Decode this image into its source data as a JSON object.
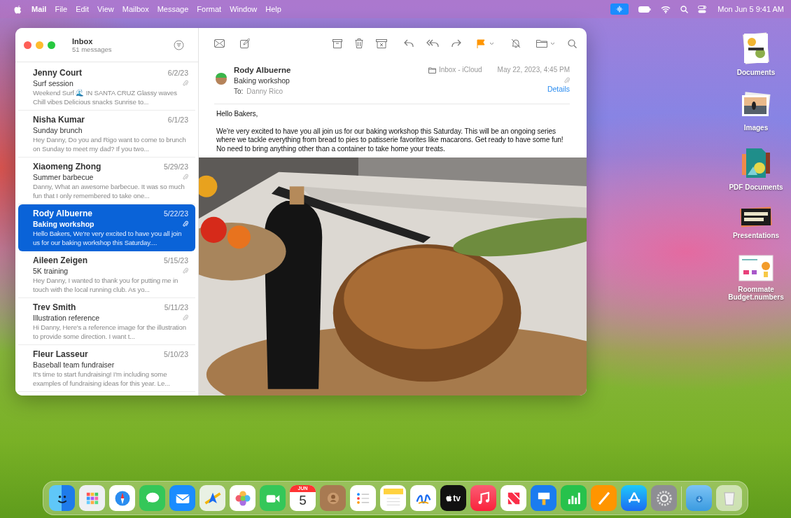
{
  "menu_bar": {
    "app": "Mail",
    "items": [
      "File",
      "Edit",
      "View",
      "Mailbox",
      "Message",
      "Format",
      "Window",
      "Help"
    ],
    "clock": "Mon Jun 5 9:41 AM"
  },
  "mailbox": {
    "title": "Inbox",
    "count": "51 messages"
  },
  "messages": [
    {
      "sender": "Jenny Court",
      "date": "6/2/23",
      "subject": "Surf session",
      "preview": "Weekend Surf 🌊 IN SANTA CRUZ Glassy waves Chill vibes Delicious snacks Sunrise to...",
      "attachment": true,
      "selected": false
    },
    {
      "sender": "Nisha Kumar",
      "date": "6/1/23",
      "subject": "Sunday brunch",
      "preview": "Hey Danny, Do you and Rigo want to come to brunch on Sunday to meet my dad? If you two...",
      "attachment": false,
      "selected": false
    },
    {
      "sender": "Xiaomeng Zhong",
      "date": "5/29/23",
      "subject": "Summer barbecue",
      "preview": "Danny, What an awesome barbecue. It was so much fun that I only remembered to take one...",
      "attachment": true,
      "selected": false
    },
    {
      "sender": "Rody Albuerne",
      "date": "5/22/23",
      "subject": "Baking workshop",
      "preview": "Hello Bakers, We're very excited to have you all join us for our baking workshop this Saturday....",
      "attachment": true,
      "selected": true
    },
    {
      "sender": "Aileen Zeigen",
      "date": "5/15/23",
      "subject": "5K training",
      "preview": "Hey Danny, I wanted to thank you for putting me in touch with the local running club. As yo...",
      "attachment": true,
      "selected": false
    },
    {
      "sender": "Trev Smith",
      "date": "5/11/23",
      "subject": "Illustration reference",
      "preview": "Hi Danny, Here's a reference image for the illustration to provide some direction. I want t...",
      "attachment": true,
      "selected": false
    },
    {
      "sender": "Fleur Lasseur",
      "date": "5/10/23",
      "subject": "Baseball team fundraiser",
      "preview": "It's time to start fundraising! I'm including some examples of fundraising ideas for this year. Le...",
      "attachment": false,
      "selected": false
    }
  ],
  "reader": {
    "sender": "Rody Albuerne",
    "subject": "Baking workshop",
    "to_label": "To:",
    "to": "Danny Rico",
    "mailbox": "Inbox - iCloud",
    "date": "May 22, 2023, 4:45 PM",
    "attachment": true,
    "details": "Details",
    "flagged": true,
    "greeting": "Hello Bakers,",
    "body": "We're very excited to have you all join us for our baking workshop this Saturday. This will be an ongoing series where we tackle everything from bread to pies to patisserie favorites like macarons. Get ready to have some fun! No need to bring anything other than a container to take home your treats."
  },
  "desktop_items": [
    {
      "label": "Documents",
      "kind": "stack"
    },
    {
      "label": "Images",
      "kind": "photos"
    },
    {
      "label": "PDF Documents",
      "kind": "pdfs"
    },
    {
      "label": "Presentations",
      "kind": "slides"
    },
    {
      "label": "Roommate Budget.numbers",
      "kind": "sheet"
    }
  ],
  "dock": {
    "calendar_month": "JUN",
    "calendar_day": "5",
    "tv_label": "tv"
  }
}
